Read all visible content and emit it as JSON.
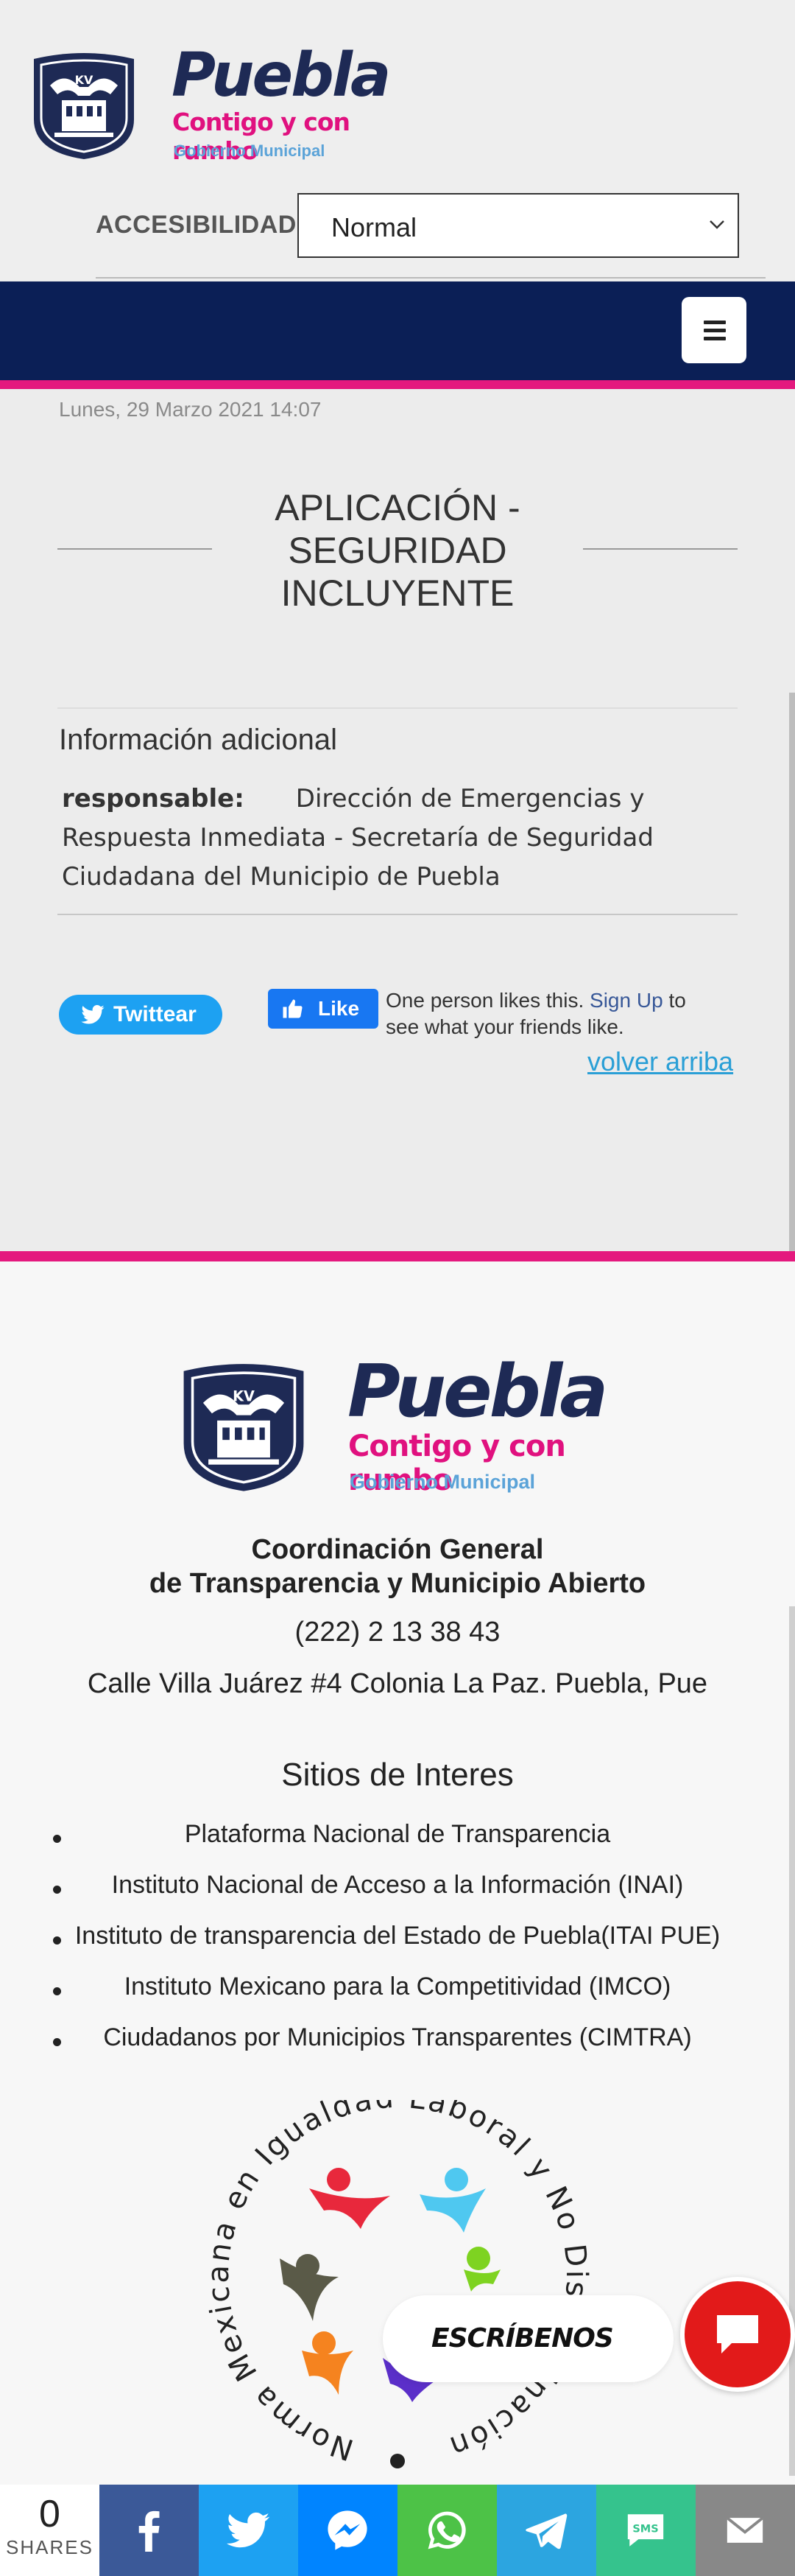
{
  "brand": {
    "name": "Puebla",
    "slogan": "Contigo y con rumbo",
    "government": "Gobierno Municipal",
    "shield_text": "KV"
  },
  "accessibility": {
    "label": "ACCESIBILIDAD",
    "selected": "Normal"
  },
  "navbar": {
    "menu_icon": "hamburger-icon"
  },
  "article": {
    "date": "Lunes, 29 Marzo 2021 14:07",
    "title": "APLICACIÓN - SEGURIDAD INCLUYENTE",
    "info_heading": "Información adicional",
    "responsable_label": "responsable:",
    "responsable_value": "Dirección de Emergencias y Respuesta Inmediata - Secretaría de Seguridad Ciudadana del Municipio de Puebla"
  },
  "social": {
    "twitter_label": "Twittear",
    "like_label": "Like",
    "like_text": "One person likes this.",
    "signup_label": "Sign Up",
    "signup_suffix": "to see what your friends like.",
    "back_to_top": "volver arriba"
  },
  "footer": {
    "coord_line1": "Coordinación General",
    "coord_line2": "de Transparencia y Municipio Abierto",
    "phone": "(222) 2 13 38 43",
    "address": "Calle Villa Juárez #4 Colonia La Paz. Puebla, Pue",
    "sites_heading": "Sitios de Interes",
    "sites": [
      "Plataforma Nacional de Transparencia",
      "Instituto Nacional de Acceso a la Información (INAI)",
      "Instituto de transparencia del Estado de Puebla(ITAI PUE)",
      "Instituto Mexicano para la Competitividad (IMCO)",
      "Ciudadanos por Municipios Transparentes (CIMTRA)"
    ],
    "badge_text": "Norma Mexicana en Igualdad Laboral y No Discriminación"
  },
  "chat": {
    "label": "ESCRÍBENOS"
  },
  "share": {
    "count": "0",
    "count_label": "SHARES",
    "sms_label": "SMS",
    "colors": {
      "facebook": "#3b5998",
      "twitter": "#1da1f2",
      "messenger": "#0084ff",
      "whatsapp": "#4dc247",
      "telegram": "#2ca5e0",
      "sms": "#35c38d",
      "email": "#888888"
    }
  },
  "colors": {
    "navy": "#0b1f56",
    "pink": "#e4197e",
    "link_blue": "#2a9fd6",
    "chat_red": "#e21a1a"
  }
}
